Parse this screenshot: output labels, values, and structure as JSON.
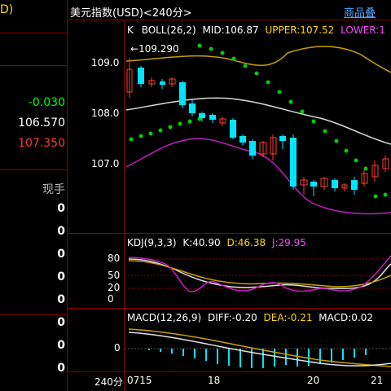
{
  "left_panel": {
    "title_fragment": "D)",
    "change": "-0.030",
    "price": "106.570",
    "high": "107.350",
    "section_label": "现手",
    "zeros": [
      "0",
      "0",
      "0",
      "0",
      "0",
      "0",
      "0",
      "0"
    ],
    "period": "240分"
  },
  "header": {
    "title": "美元指数(USD)<240分>",
    "link": "商品叠"
  },
  "main": {
    "k_label": "K",
    "boll_label": "BOLL(26,2)",
    "mid": "MID:106.87",
    "upper": "UPPER:107.52",
    "lower": "LOWER:1",
    "peak_label": "109.290",
    "y_ticks": [
      "109.0",
      "108.0",
      "107.0"
    ]
  },
  "kdj": {
    "label": "KDJ(9,3,3)",
    "k": "K:40.90",
    "d": "D:46.38",
    "j": "J:29.95",
    "ticks": [
      "80",
      "50",
      "20",
      "0"
    ]
  },
  "macd": {
    "label": "MACD(12,26,9)",
    "diff": "DIFF:-0.20",
    "dea": "DEA:-0.21",
    "macd": "MACD:0.02",
    "tick": "0"
  },
  "dates": [
    "0715",
    "18",
    "20",
    "21"
  ],
  "colors": {
    "up": "#ff3b30",
    "down": "#00e5ff",
    "grid": "#8b0000",
    "upper": "#c8a000",
    "mid": "#d9d9d9",
    "lower": "#c020c0",
    "sar": "#00d000"
  }
}
